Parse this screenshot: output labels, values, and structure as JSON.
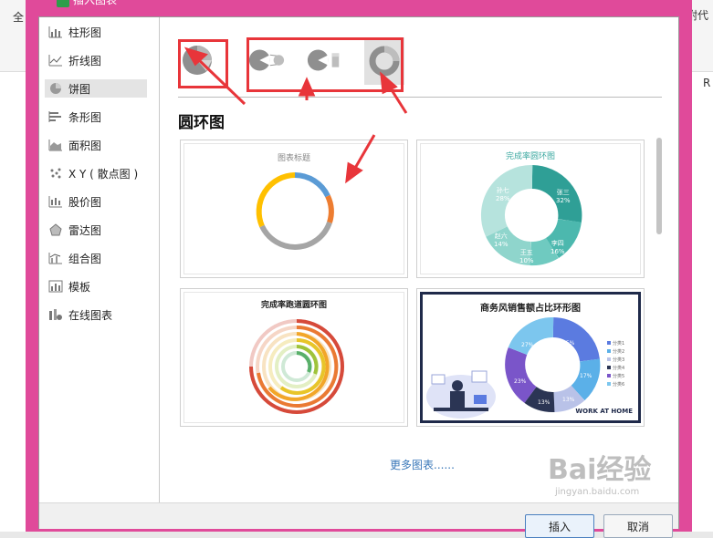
{
  "background": {
    "left_text": "全",
    "right_text": "附代",
    "column_label": "R"
  },
  "dialog": {
    "title": "插入图表"
  },
  "sidebar": {
    "items": [
      {
        "label": "柱形图",
        "icon": "column-chart-icon"
      },
      {
        "label": "折线图",
        "icon": "line-chart-icon"
      },
      {
        "label": "饼图",
        "icon": "pie-chart-icon",
        "selected": true
      },
      {
        "label": "条形图",
        "icon": "bar-chart-icon"
      },
      {
        "label": "面积图",
        "icon": "area-chart-icon"
      },
      {
        "label": "X Y ( 散点图 )",
        "icon": "scatter-chart-icon"
      },
      {
        "label": "股价图",
        "icon": "stock-chart-icon"
      },
      {
        "label": "雷达图",
        "icon": "radar-chart-icon"
      },
      {
        "label": "组合图",
        "icon": "combo-chart-icon"
      },
      {
        "label": "模板",
        "icon": "template-icon"
      },
      {
        "label": "在线图表",
        "icon": "online-chart-icon"
      }
    ]
  },
  "main": {
    "subtypes": [
      "pie",
      "pie-of-pie",
      "bar-of-pie",
      "doughnut"
    ],
    "section_title": "圆环图",
    "cards": [
      {
        "title": "图表标题"
      },
      {
        "title": "完成率圆环图",
        "labels": [
          "张三\n32%",
          "李四\n16%",
          "王五\n10%",
          "赵六\n14%",
          "孙七\n28%"
        ]
      },
      {
        "title": "完成率跑道圆环图"
      },
      {
        "title": "商务风销售额占比环形图",
        "slices": [
          "25%",
          "17%",
          "13%",
          "13%",
          "23%",
          "27%"
        ],
        "legend": [
          "分类1",
          "分类2",
          "分类3",
          "分类4",
          "分类5",
          "分类6"
        ],
        "badge": "WORK AT HOME"
      }
    ],
    "more_link": "更多图表......"
  },
  "footer": {
    "insert_label": "插入",
    "cancel_label": "取消"
  },
  "watermark": {
    "text": "Bai经验",
    "subtext": "jingyan.baidu.com"
  },
  "colors": {
    "frame": "#e04a9a",
    "annotation": "#e8353a",
    "teal": "#3aa8a0",
    "link": "#3a78b9"
  }
}
